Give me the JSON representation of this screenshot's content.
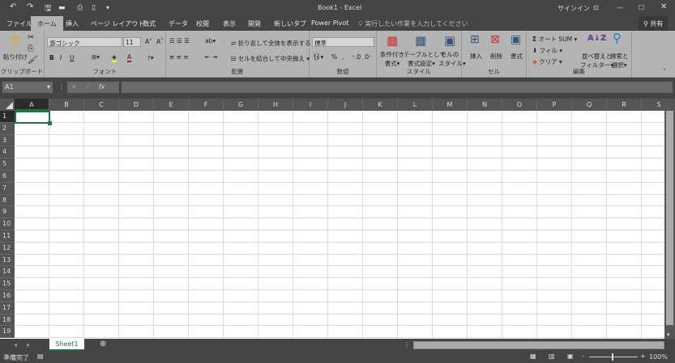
{
  "titlebar": {
    "title": "Book1 - Excel",
    "signin": "サインイン",
    "qat": [
      "undo-icon",
      "redo-icon",
      "save-icon",
      "open-icon",
      "print-preview-icon",
      "new-icon",
      "customize-icon"
    ]
  },
  "tabs": [
    "ファイル",
    "ホーム",
    "挿入",
    "ページ レイアウト",
    "数式",
    "データ",
    "校閲",
    "表示",
    "開発",
    "新しいタブ",
    "Power Pivot"
  ],
  "tellme": "実行したい作業を入力してください",
  "share": "共有",
  "ribbon": {
    "clipboard": {
      "label": "クリップボード",
      "paste": "貼り付け"
    },
    "font": {
      "label": "フォント",
      "name": "游ゴシック",
      "size": "11",
      "bold": "B",
      "italic": "I",
      "underline": "U"
    },
    "alignment": {
      "label": "配置",
      "wrap": "折り返して全体を表示する",
      "merge": "セルを結合して中央揃え"
    },
    "number": {
      "label": "数値",
      "format": "標準",
      "percent": "%",
      "comma": ","
    },
    "styles": {
      "label": "スタイル",
      "conditional": [
        "条件付き",
        "書式"
      ],
      "table": [
        "テーブルとして",
        "書式設定"
      ],
      "cellstyle": [
        "セルの",
        "スタイル"
      ]
    },
    "cells": {
      "label": "セル",
      "insert": "挿入",
      "delete": "削除",
      "format": "書式"
    },
    "editing": {
      "label": "編集",
      "autosum": "オート SUM",
      "fill": "フィル",
      "clear": "クリア",
      "sort": [
        "並べ替えと",
        "フィルター"
      ],
      "find": [
        "検索と",
        "選択"
      ]
    }
  },
  "formula": {
    "namebox": "A1",
    "fx": "fx",
    "value": ""
  },
  "columns": [
    "A",
    "B",
    "C",
    "D",
    "E",
    "F",
    "G",
    "H",
    "I",
    "J",
    "K",
    "L",
    "M",
    "N",
    "O",
    "P",
    "Q",
    "R",
    "S"
  ],
  "rows": [
    "1",
    "2",
    "3",
    "4",
    "5",
    "6",
    "7",
    "8",
    "9",
    "10",
    "11",
    "12",
    "13",
    "14",
    "15",
    "16",
    "17",
    "18",
    "19"
  ],
  "selected_cell": "A1",
  "sheets": [
    "Sheet1"
  ],
  "status": {
    "ready": "準備完了",
    "zoom": "100%"
  },
  "colors": {
    "accent": "#217346",
    "ribbon": "#b4b4b4",
    "chrome": "#444444"
  }
}
